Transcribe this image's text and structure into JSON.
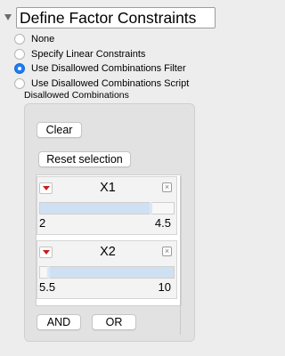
{
  "header": {
    "title": "Define Factor Constraints"
  },
  "constraint_options": [
    {
      "label": "None",
      "selected": false
    },
    {
      "label": "Specify Linear Constraints",
      "selected": false
    },
    {
      "label": "Use Disallowed Combinations Filter",
      "selected": true
    },
    {
      "label": "Use Disallowed Combinations Script",
      "selected": false
    }
  ],
  "disallowed": {
    "section_label": "Disallowed Combinations",
    "clear_label": "Clear",
    "reset_label": "Reset selection",
    "factors": [
      {
        "name": "X1",
        "min": "2",
        "max": "4.5",
        "selected_from": 0.0,
        "selected_to": 0.82
      },
      {
        "name": "X2",
        "min": "5.5",
        "max": "10",
        "selected_from": 0.05,
        "selected_to": 1.0
      }
    ],
    "and_label": "AND",
    "or_label": "OR"
  },
  "colors": {
    "accent": "#1e7cf4",
    "menu_arrow": "#c81e1e",
    "slider_fill": "#cfe0f3"
  }
}
